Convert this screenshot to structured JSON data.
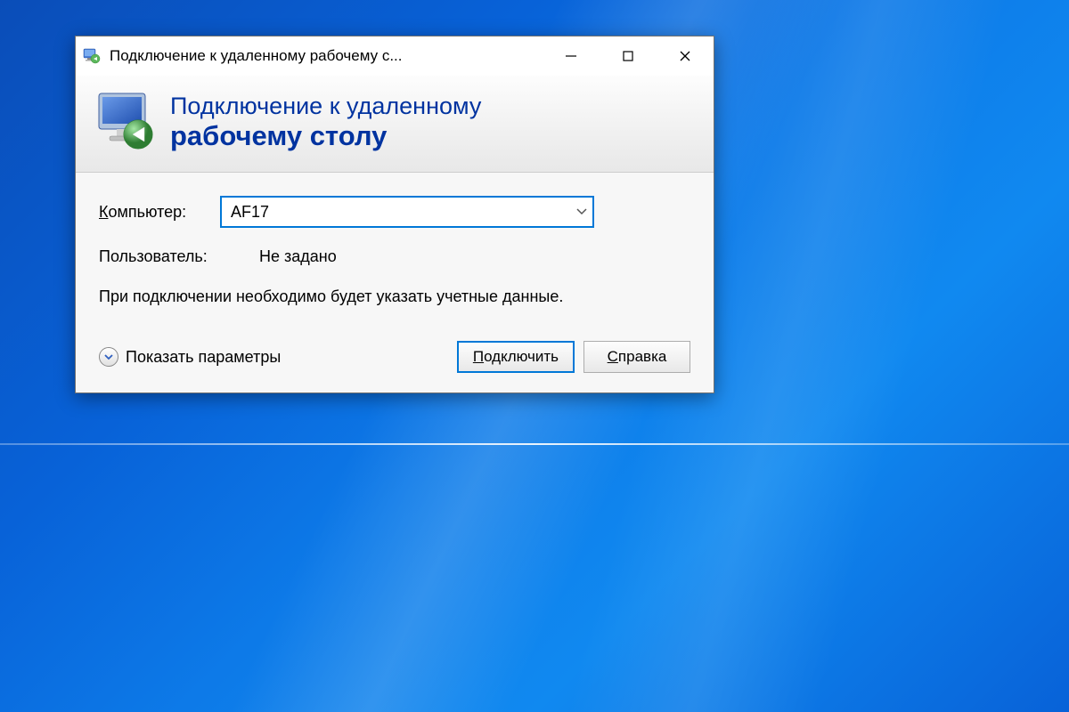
{
  "window": {
    "title": "Подключение к удаленному рабочему с..."
  },
  "header": {
    "line1": "Подключение к удаленному",
    "line2": "рабочему столу"
  },
  "form": {
    "computer_label_prefix": "К",
    "computer_label_rest": "омпьютер:",
    "computer_value": "AF17",
    "user_label": "Пользователь:",
    "user_value": "Не задано",
    "info_text": "При подключении необходимо будет указать учетные данные."
  },
  "actions": {
    "show_params_prefix": "П",
    "show_params_rest": "оказать параметры",
    "connect_prefix": "П",
    "connect_rest": "одключить",
    "help_prefix": "С",
    "help_rest": "правка"
  }
}
